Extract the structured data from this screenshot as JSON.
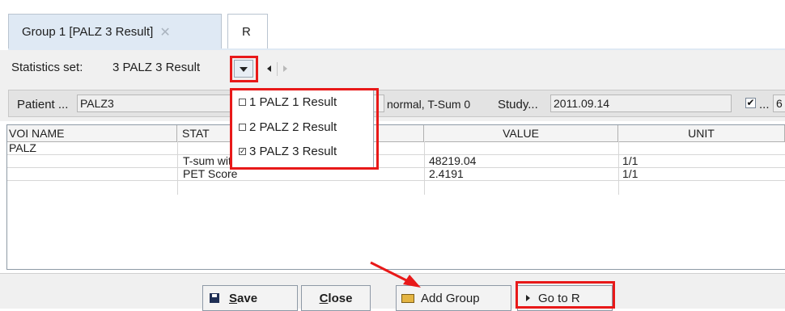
{
  "tabs": [
    {
      "label": "Group 1 [PALZ 3 Result]",
      "close_glyph": "✕",
      "active": true
    },
    {
      "label": "R",
      "active": false
    }
  ],
  "statistics": {
    "label": "Statistics set:",
    "value": "3 PALZ 3 Result"
  },
  "info": {
    "patient_label": "Patient ...",
    "patient_value": "PALZ3",
    "type_value": "normal, T-Sum 0",
    "study_label": "Study...",
    "study_value": "2011.09.14",
    "check_mark": "✔",
    "extra_label": "...",
    "extra_value": "6"
  },
  "dropdown": {
    "items": [
      {
        "label": "1 PALZ 1 Result",
        "checked": false,
        "mark": ""
      },
      {
        "label": "2 PALZ 2 Result",
        "checked": false,
        "mark": ""
      },
      {
        "label": "3 PALZ 3 Result",
        "checked": true,
        "mark": "✓"
      }
    ]
  },
  "table": {
    "headers": [
      "VOI NAME",
      "STAT",
      "VALUE",
      "UNIT"
    ],
    "rows": [
      {
        "voi": "PALZ",
        "stat": "",
        "value": "",
        "unit": ""
      },
      {
        "voi": "",
        "stat": "T-sum within AD regions",
        "value": "48219.04",
        "unit": "1/1"
      },
      {
        "voi": "",
        "stat": "PET Score",
        "value": "2.4191",
        "unit": "1/1"
      }
    ]
  },
  "buttons": {
    "save_mnemonic": "S",
    "save_rest": "ave",
    "close_mnemonic": "C",
    "close_rest": "lose",
    "add_group": "Add Group",
    "go_to_r": "Go to R"
  },
  "colors": {
    "highlight": "#e81919",
    "tab_active_bg": "#dfe9f4",
    "panel_bg": "#f0f0f0"
  },
  "icons": [
    "close-icon",
    "dropdown-arrow-icon",
    "previous-arrow-icon",
    "next-arrow-icon",
    "checkbox-icon",
    "floppy-disk-icon",
    "folder-open-icon",
    "play-icon",
    "pointer-arrow-icon"
  ]
}
